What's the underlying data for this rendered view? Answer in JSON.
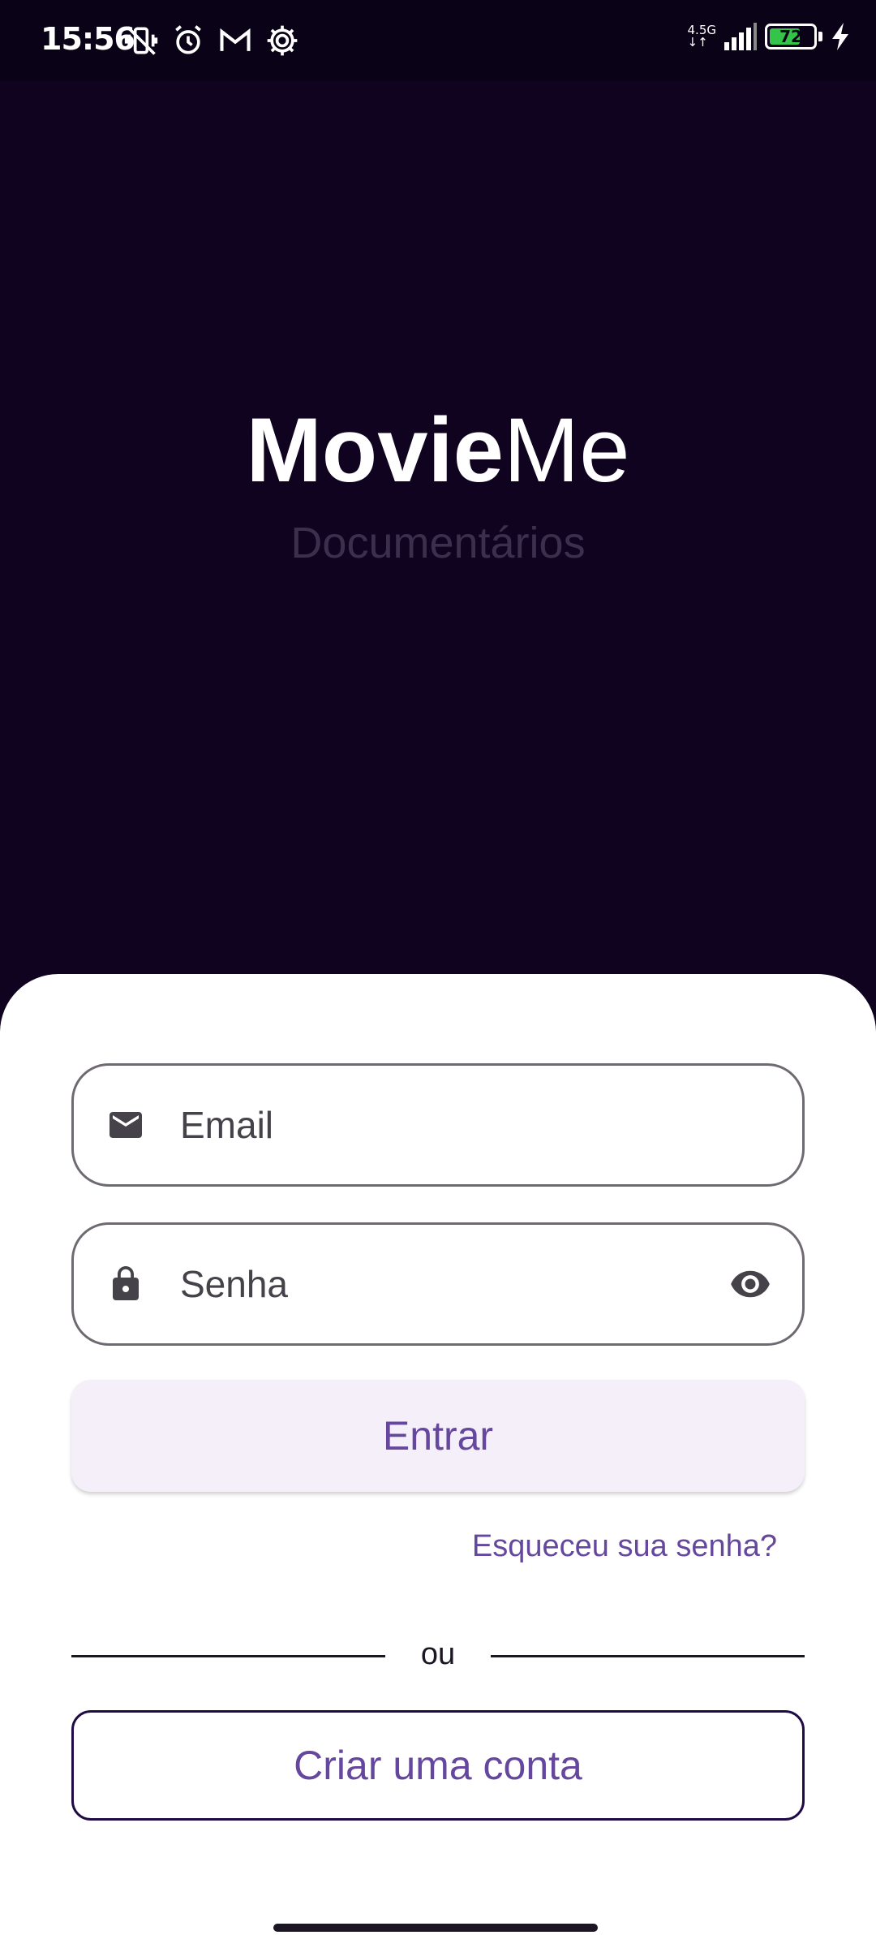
{
  "status_bar": {
    "time": "15:56",
    "network_type_top": "4.5G",
    "network_type_bottom": "↓↑",
    "battery_level": "72",
    "battery_fraction": 0.72,
    "icons_left": [
      "vibrate-off-icon",
      "alarm-icon",
      "gmail-icon",
      "settings-gear-icon"
    ],
    "icons_right": [
      "signal-icon",
      "battery-icon",
      "charging-bolt-icon"
    ]
  },
  "brand": {
    "bold": "Movie",
    "light": "Me",
    "subtitle": "Documentários"
  },
  "form": {
    "email_placeholder": "Email",
    "password_placeholder": "Senha",
    "email_icon": "mail-icon",
    "password_icon": "lock-icon",
    "visibility_icon": "eye-icon",
    "submit_label": "Entrar",
    "forgot_label": "Esqueceu sua senha?",
    "divider_label": "ou",
    "create_account_label": "Criar uma conta"
  },
  "colors": {
    "background": "#0f0320",
    "sheet": "#ffffff",
    "accent": "#65489e",
    "primary_button_bg": "#f4eff8",
    "battery_green": "#34c44a"
  }
}
